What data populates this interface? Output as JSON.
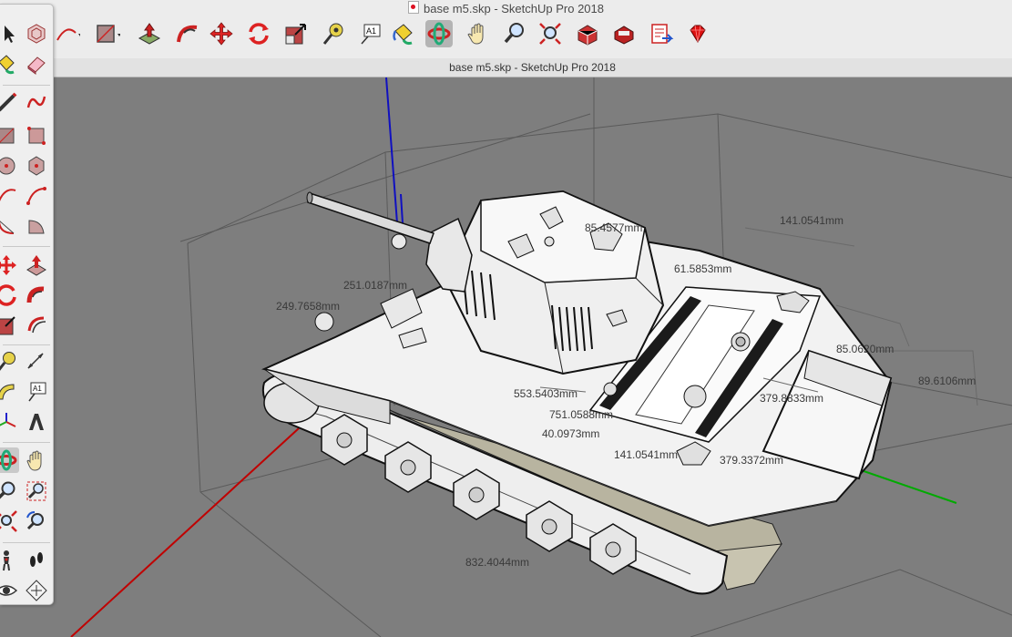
{
  "window": {
    "title": "base m5.skp - SketchUp Pro 2018"
  },
  "tab": {
    "title": "base m5.skp - SketchUp Pro 2018"
  },
  "toolbar": {
    "items": [
      "arc-tool",
      "rectangle-tool",
      "push-pull-tool",
      "follow-me-tool",
      "move-tool",
      "rotate-tool",
      "scale-tool",
      "tape-measure-tool",
      "text-tool",
      "paint-bucket-tool",
      "orbit-tool",
      "pan-tool",
      "zoom-tool",
      "zoom-extents-tool",
      "3d-warehouse-tool",
      "extension-warehouse-tool",
      "layout-send-tool",
      "extension-manager-tool"
    ],
    "active": "orbit-tool",
    "text_label": "A1"
  },
  "tool_palette": {
    "items": [
      "select",
      "make-component",
      "paint-bucket",
      "eraser",
      "line",
      "freehand",
      "rectangle",
      "rotated-rectangle",
      "circle",
      "polygon",
      "arc",
      "two-point-arc",
      "three-point-arc",
      "pie",
      "move",
      "push-pull",
      "rotate",
      "follow-me",
      "scale",
      "offset",
      "tape-measure",
      "dimension",
      "protractor",
      "text",
      "axes",
      "3d-text",
      "orbit",
      "pan",
      "zoom",
      "zoom-window",
      "zoom-extents",
      "previous-view",
      "position-camera",
      "walk",
      "look-around",
      "section-plane"
    ],
    "text_label": "A1"
  },
  "dimensions": [
    {
      "text": "141.0541mm"
    },
    {
      "text": "85.4577mm"
    },
    {
      "text": "61.5853mm"
    },
    {
      "text": "251.0187mm"
    },
    {
      "text": "249.7658mm"
    },
    {
      "text": "85.0620mm"
    },
    {
      "text": "89.6106mm"
    },
    {
      "text": "553.5403mm"
    },
    {
      "text": "379.8833mm"
    },
    {
      "text": "751.0588mm"
    },
    {
      "text": "40.0973mm"
    },
    {
      "text": "141.0541mm"
    },
    {
      "text": "379.3372mm"
    },
    {
      "text": "832.4044mm"
    }
  ],
  "colors": {
    "background": "#7e7e7e",
    "axis_red": "#c00000",
    "axis_green": "#00aa00",
    "axis_blue": "#1010c0",
    "model_face": "#f2f2f2",
    "model_back": "#b8b4a0"
  }
}
